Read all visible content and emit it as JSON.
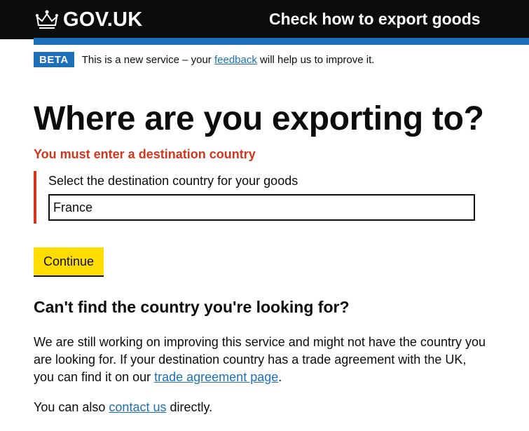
{
  "header": {
    "logo_text": "GOV.UK",
    "service_name": "Check how to export goods"
  },
  "phase_banner": {
    "tag": "BETA",
    "text_before": "This is a new service – your ",
    "link_text": "feedback",
    "text_after": " will help us to improve it."
  },
  "page": {
    "title": "Where are you exporting to?",
    "error_message": "You must enter a destination country",
    "field_label": "Select the destination country for your goods",
    "field_value": "France",
    "continue_label": "Continue"
  },
  "help": {
    "heading": "Can't find the country you're looking for?",
    "p1_text": "We are still working on improving this service and might not have the country you are looking for. If your destination country has a trade agreement with the UK, you can find it on our ",
    "p1_link": "trade agreement page",
    "p1_end": ".",
    "p2_text": "You can also ",
    "p2_link": "contact us",
    "p2_end": " directly."
  },
  "colors": {
    "header_bg": "#0b0c0c",
    "brand_blue": "#1d70b8",
    "error_red": "#d4351c",
    "button_yellow": "#ffdd00"
  }
}
